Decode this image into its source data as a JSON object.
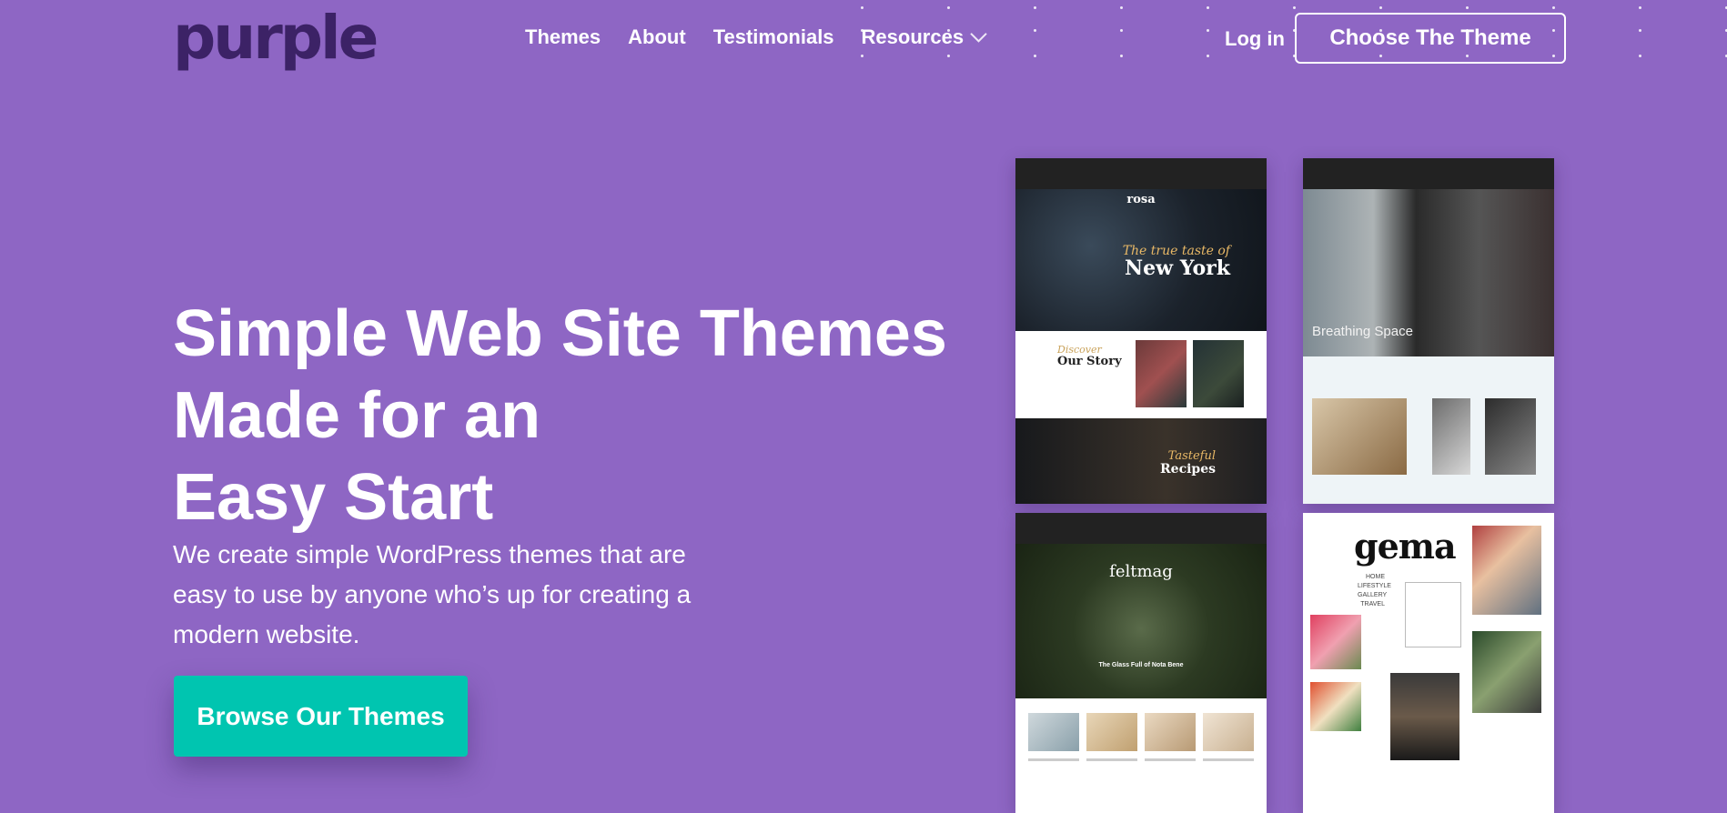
{
  "header": {
    "logo": "purple",
    "nav": [
      "Themes",
      "About",
      "Testimonials",
      "Resources"
    ],
    "login": "Log in",
    "cta": "Choose The Theme"
  },
  "hero": {
    "title_lines": [
      "Simple Web Site Themes",
      "Made for an",
      "Easy Start"
    ],
    "subtitle": "We create simple WordPress themes that are easy to use by anyone who’s up for creating a modern website.",
    "button": "Browse Our Themes"
  },
  "cards": {
    "rosa": {
      "brand": "rosa",
      "tagline_script": "The true taste of",
      "tagline": "New York",
      "story_script": "Discover",
      "story": "Our Story",
      "recipes_script": "Tasteful",
      "recipes": "Recipes"
    },
    "breathing": {
      "title": "Breathing Space"
    },
    "feltmag": {
      "brand": "feltmag",
      "caption": "The Glass Full of Nota Bene"
    },
    "gema": {
      "brand": "gema",
      "menu": [
        "HOME",
        "LIFESTYLE",
        "GALLERY",
        "TRAVEL"
      ]
    }
  },
  "colors": {
    "background": "#8e66c4",
    "logo": "#3c2266",
    "cta_teal": "#00c5b0"
  }
}
